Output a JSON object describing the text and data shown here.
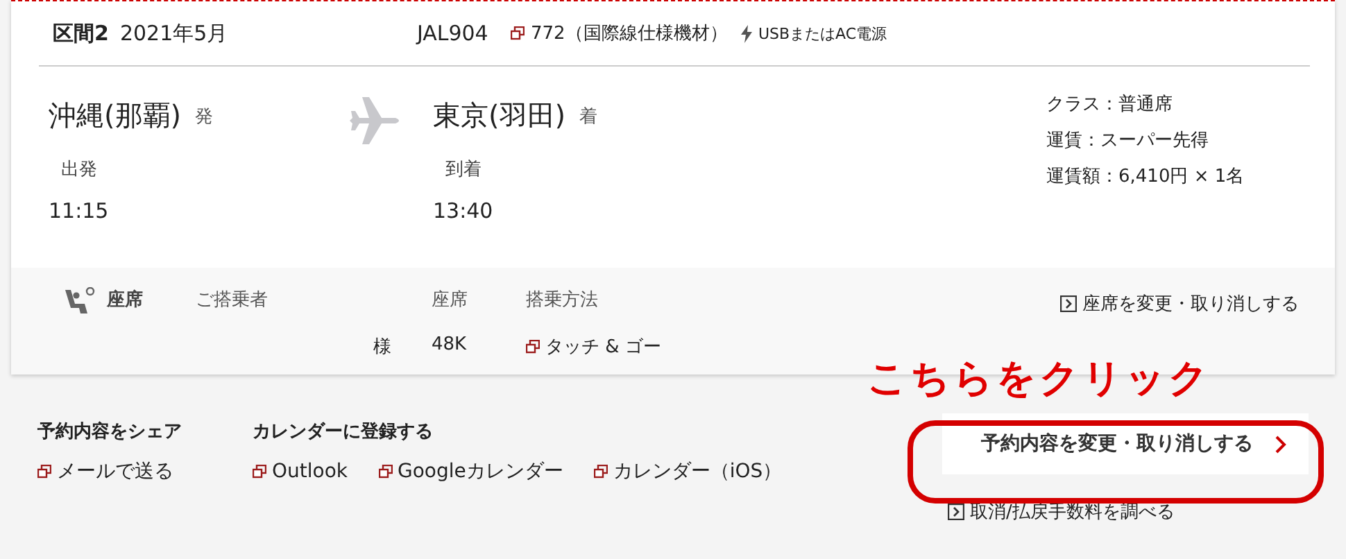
{
  "segment": {
    "label": "区間2",
    "month": "2021年5月",
    "flight": "JAL904",
    "aircraft": "772（国際線仕様機材）",
    "power": "USBまたはAC電源"
  },
  "route": {
    "from": {
      "city": "沖縄(那覇)",
      "suffix": "発",
      "time_label": "出発",
      "time": "11:15"
    },
    "to": {
      "city": "東京(羽田)",
      "suffix": "着",
      "time_label": "到着",
      "time": "13:40"
    },
    "fare_info": [
      "クラス：普通席",
      "運賃：スーパー先得",
      "運賃額：6,410円 × 1名"
    ]
  },
  "seat": {
    "title": "座席",
    "columns": [
      {
        "label": "ご搭乗者",
        "value": "様",
        "kind": "passenger"
      },
      {
        "label": "座席",
        "value": "48K",
        "kind": "plain"
      },
      {
        "label": "搭乗方法",
        "value": "タッチ & ゴー",
        "kind": "link"
      }
    ],
    "change_link": "座席を変更・取り消しする"
  },
  "annotation": "こちらをクリック",
  "share": {
    "title": "予約内容をシェア",
    "links": [
      "メールで送る"
    ]
  },
  "calendar": {
    "title": "カレンダーに登録する",
    "links": [
      "Outlook",
      "Googleカレンダー",
      "カレンダー（iOS）"
    ]
  },
  "change_button": "予約内容を変更・取り消しする",
  "fee_link": "取消/払戻手数料を調べる"
}
